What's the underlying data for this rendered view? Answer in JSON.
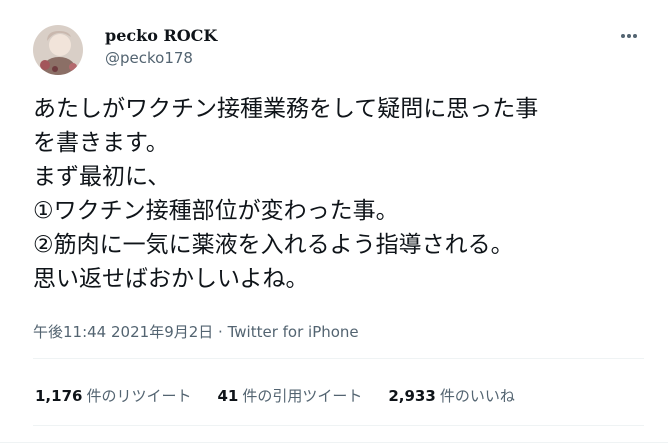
{
  "user": {
    "display_name": "pecko ROCK",
    "handle": "@pecko178"
  },
  "more_icon": "more-horizontal-icon",
  "tweet": {
    "lines": [
      "あたしがワクチン接種業務をして疑問に思った事",
      "を書きます。",
      "まず最初に、",
      "①ワクチン接種部位が変わった事。",
      "②筋肉に一気に薬液を入れるよう指導される。",
      "思い返せばおかしいよね。"
    ]
  },
  "meta": {
    "time": "午後11:44",
    "date": "2021年9月2日",
    "separator": " · ",
    "source": "Twitter for iPhone"
  },
  "stats": {
    "retweets": {
      "count": "1,176",
      "label": "件のリツイート"
    },
    "quotes": {
      "count": "41",
      "label": "件の引用ツイート"
    },
    "likes": {
      "count": "2,933",
      "label": "件のいいね"
    }
  },
  "colors": {
    "primary_text": "#0f1419",
    "secondary_text": "#536471",
    "divider": "#eff3f4"
  }
}
